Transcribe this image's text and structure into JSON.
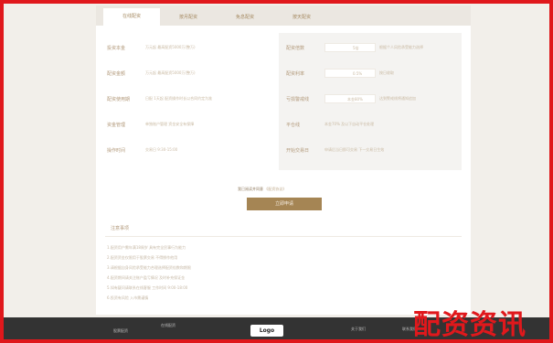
{
  "tabs": [
    "在线配资",
    "按月配资",
    "免息配资",
    "按天配资"
  ],
  "left_fields": [
    {
      "label": "投资本金",
      "value": "万元起 最高配资5000万(整万)"
    },
    {
      "label": "配资金额",
      "value": "万元起 最高配资5000万(整万)"
    },
    {
      "label": "配资使用期",
      "value": "日配 1天起 配资操作时长以合同约定为准"
    },
    {
      "label": "资金管理",
      "value": "单独账户管理 资金安全有保障"
    },
    {
      "label": "操作时间",
      "value": "交易日 9:30-15:00"
    }
  ],
  "right_fields": [
    {
      "label": "配资倍数",
      "value": "5倍",
      "extra": "根据个人风险承受能力选择"
    },
    {
      "label": "配资利率",
      "value": "0.5%",
      "extra": "按日收取"
    },
    {
      "label": "亏损警戒线",
      "value": "本金80%",
      "extra": "达到警戒线将通知追加"
    },
    {
      "label": "平仓线",
      "value": "本金70% 及以下自动平仓处理",
      "extra": ""
    },
    {
      "label": "开始交易日",
      "value": "申请后当日即可交易 下一交易日生效",
      "extra": ""
    }
  ],
  "hint": {
    "text": "我已阅读并同意",
    "link": "《配资协议》"
  },
  "submit_label": "立即申请",
  "notes_title": "注意事项",
  "notes": [
    "1.配资用户需年满18周岁 具有完全民事行为能力",
    "2.配资资金仅限用于股票交易 不得挪作他用",
    "3.请根据自身风险承受能力合理选择配资倍数和期限",
    "4.配资期间请关注账户盈亏情况 及时补充保证金",
    "5.如有疑问请联系在线客服 工作时间 9:00-18:00",
    "6.投资有风险 入市需谨慎"
  ],
  "footer": {
    "left": "股票配资",
    "mid_left": "在线配资",
    "logo": "Logo",
    "right1": "关于我们",
    "right2": "联系我们"
  },
  "watermark": "配资资讯",
  "colors": {
    "accent": "#a58554",
    "frame": "#e0181c",
    "footer": "#333333"
  }
}
